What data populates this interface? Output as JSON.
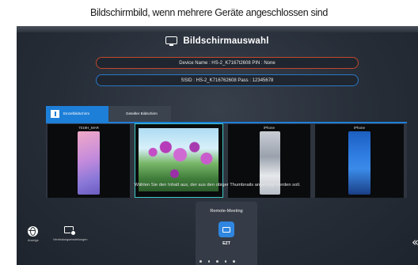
{
  "caption": "Bildschirmbild, wenn mehrere Geräte angeschlossen sind",
  "window": {
    "title": "Bildschirmauswahl",
    "title_icon": "monitor-icon"
  },
  "connection_info": {
    "device_line": "Device Name : HS-2_K7167t2608   PIN : None",
    "ssid_line": "SSID : HS-2_K716762608   Pass : 12345678",
    "device_border_color": "#c0482f",
    "ssid_border_color": "#2a78c6"
  },
  "tabs": [
    {
      "label": "Einzelbildschirm",
      "icon": "single-screen-icon",
      "active": true
    },
    {
      "label": "Geteilter Bildschirm",
      "icon": "split-screen-icon",
      "active": false
    }
  ],
  "thumbnails": [
    {
      "label": "7019H_MAR",
      "content": "phone-screen",
      "selected": false
    },
    {
      "label": "",
      "content": "flower-photo",
      "selected": true
    },
    {
      "label": "iPhone",
      "content": "phone-screen",
      "selected": false
    },
    {
      "label": "iPhone",
      "content": "phone-screen",
      "selected": false
    }
  ],
  "instruction": "Wählen Sie den Inhalt aus, der aus den obiger Thumbnails angezeigt werden soll.",
  "bottom_left": [
    {
      "label": "Anzeige",
      "icon": "globe-icon"
    },
    {
      "label": "Verbindungseinstellungen",
      "icon": "connection-settings-icon"
    }
  ],
  "remote_meeting": {
    "label": "Remote-Meeting",
    "app_label": "EZT",
    "app_icon": "ezt-icon"
  },
  "collapse_icon": "chevron-double-left-icon",
  "colors": {
    "accent": "#1e7fd8",
    "selection": "#3fc7c4",
    "background": "#262d37"
  }
}
